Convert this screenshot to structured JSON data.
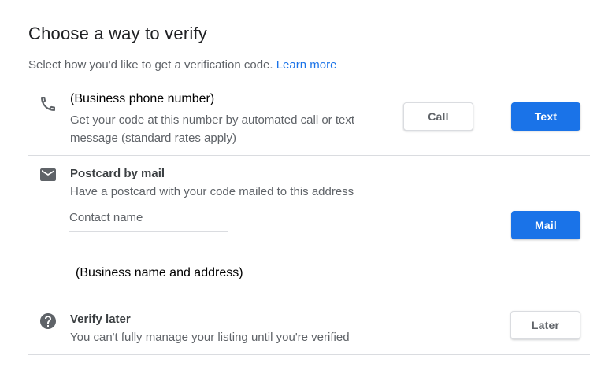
{
  "header": {
    "title": "Choose a way to verify",
    "subtitle": "Select how you'd like to get a verification code.",
    "learn_more": "Learn more"
  },
  "options": {
    "phone": {
      "title": "(Business phone number)",
      "description_line1": "Get your code at this number by automated call or text",
      "description_line2": "message (standard rates apply)",
      "call_label": "Call",
      "text_label": "Text",
      "icon": "phone-icon"
    },
    "postcard": {
      "title": "Postcard by mail",
      "description": "Have a postcard with your code mailed to this address",
      "contact_placeholder": "Contact name",
      "contact_value": "",
      "address": "(Business name and address)",
      "mail_label": "Mail",
      "icon": "mail-icon"
    },
    "later": {
      "title": "Verify later",
      "description": "You can't fully manage your listing until you're verified",
      "later_label": "Later",
      "icon": "help-icon"
    }
  },
  "colors": {
    "accent": "#1a73e8",
    "text_secondary": "#5f6368",
    "divider": "#dadce0"
  }
}
